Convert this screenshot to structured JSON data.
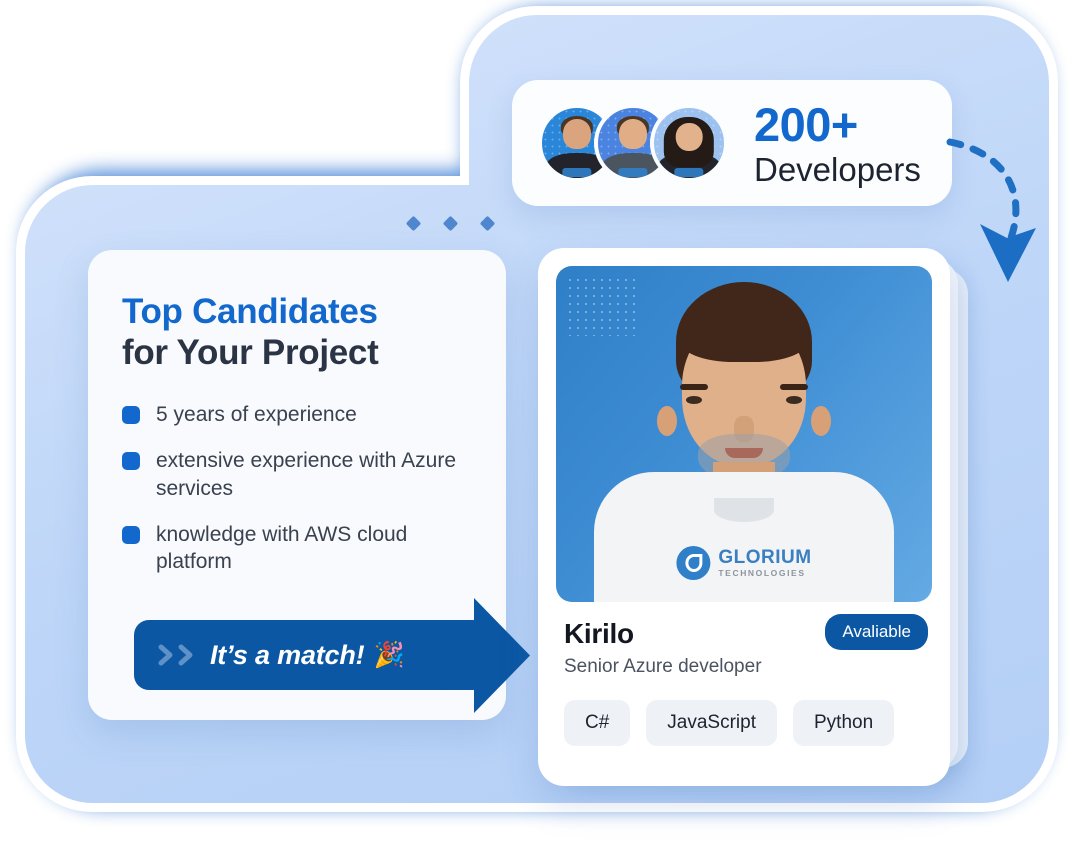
{
  "stats_pill": {
    "count": "200+",
    "label": "Developers",
    "avatars": [
      {
        "name": "avatar-developer-1"
      },
      {
        "name": "avatar-developer-2"
      },
      {
        "name": "avatar-developer-3"
      }
    ]
  },
  "left_card": {
    "heading_line1": "Top Candidates",
    "heading_line2": "for Your Project",
    "bullets": [
      "5 years of experience",
      "extensive experience with Azure services",
      "knowledge with AWS cloud platform"
    ],
    "match_button": {
      "label": "It’s a match!",
      "emoji": "🎉"
    }
  },
  "candidate_card": {
    "name": "Kirilo",
    "role": "Senior Azure developer",
    "badge": "Avaliable",
    "skills": [
      "C#",
      "JavaScript",
      "Python"
    ],
    "tshirt_logo": {
      "name": "GLORIUM",
      "subtitle": "TECHNOLOGIES"
    }
  },
  "colors": {
    "accent_blue": "#1268cc",
    "deep_blue": "#0b57a4",
    "heading_dark": "#2b3445",
    "panel_blue": "#c3daf9",
    "skill_chip": "#eef1f5"
  }
}
